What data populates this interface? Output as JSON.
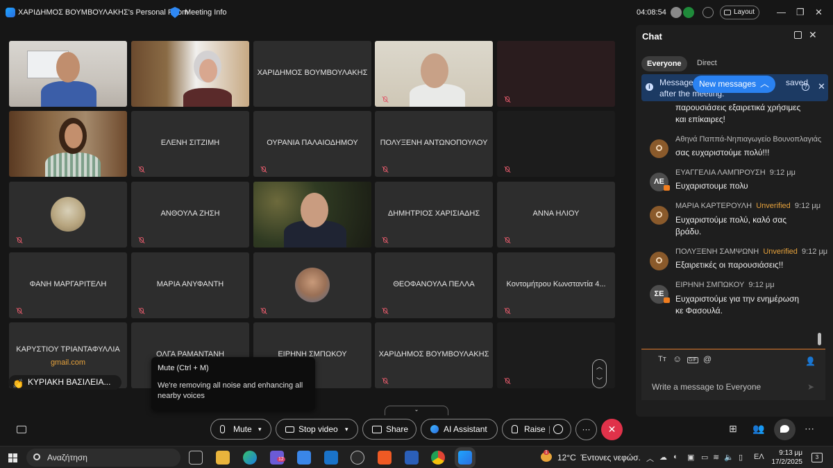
{
  "titlebar": {
    "title": "ΧΑΡΙΔΗΜΟΣ ΒΟΥΜΒΟΥΛΑΚΗΣ's Personal Room",
    "meeting_info": "Meeting Info",
    "timer": "04:08:54",
    "layout_label": "Layout"
  },
  "grid": {
    "tiles": [
      {
        "name": "",
        "type": "video"
      },
      {
        "name": "",
        "type": "video"
      },
      {
        "name": "ΧΑΡΙΔΗΜΟΣ ΒΟΥΜΒΟΥΛΑΚΗΣ",
        "type": "name"
      },
      {
        "name": "",
        "type": "video"
      },
      {
        "name": "",
        "type": "blank"
      },
      {
        "name": "",
        "type": "video"
      },
      {
        "name": "ΕΛΕΝΗ ΣΙΤΖΙΜΗ",
        "type": "name"
      },
      {
        "name": "ΟΥΡΑΝΙΑ ΠΑΛΑΙΟΔΗΜΟΥ",
        "type": "name"
      },
      {
        "name": "ΠΟΛΥΞΕΝΗ ΑΝΤΩΝΟΠΟΥΛΟΥ",
        "type": "name"
      },
      {
        "name": "",
        "type": "blank"
      },
      {
        "name": "",
        "type": "avatar"
      },
      {
        "name": "ΑΝΘΟΥΛΑ ΖΗΣΗ",
        "type": "name"
      },
      {
        "name": "",
        "type": "video"
      },
      {
        "name": "ΔΗΜΗΤΡΙΟΣ ΧΑΡΙΣΙΑΔΗΣ",
        "type": "name"
      },
      {
        "name": "ΑΝΝΑ ΗΛΙΟΥ",
        "type": "name"
      },
      {
        "name": "ΦΑΝΗ ΜΑΡΓΑΡΙΤΕΛΗ",
        "type": "name"
      },
      {
        "name": "ΜΑΡΙΑ ΑΝΥΦΑΝΤΗ",
        "type": "name"
      },
      {
        "name": "",
        "type": "avatar"
      },
      {
        "name": "ΘΕΟΦΑΝΟΥΛΑ ΠΕΛΛΑ",
        "type": "name"
      },
      {
        "name": "Κοντομήτρου Κωνσταντία 4...",
        "type": "name"
      },
      {
        "name": "ΚΑΡΥΣΤΙΟΥ ΤΡΙΑΝΤΑΦΥΛΛΙΑ",
        "type": "name",
        "sub": "gmail.com"
      },
      {
        "name": "ΟΛΓΑ ΡΑΜΑΝΤΑΝΗ",
        "type": "name"
      },
      {
        "name": "ΕΙΡΗΝΗ ΣΜΠΩΚΟΥ",
        "type": "name"
      },
      {
        "name": "ΧΑΡΙΔΗΜΟΣ ΒΟΥΜΒΟΥΛΑΚΗΣ",
        "type": "name"
      },
      {
        "name": "",
        "type": "blank"
      }
    ],
    "hand_raised_name": "ΚΥΡΙΑΚΗ ΒΑΣΙΛΕΙΑ...",
    "hand_icon": "👏"
  },
  "tooltip": {
    "title": "Mute  (Ctrl + M)",
    "body": "We're removing all noise and enhancing all nearby voices"
  },
  "controls": {
    "mute": "Mute",
    "stop_video": "Stop video",
    "share": "Share",
    "ai_assistant": "AI Assistant",
    "raise": "Raise",
    "more": "···",
    "leave": "✕"
  },
  "chat": {
    "title": "Chat",
    "tab_everyone": "Everyone",
    "tab_direct": "Direct",
    "notice_a": "Message",
    "notice_b": "saved",
    "notice_c": "after the meeting.",
    "new_messages": "New messages",
    "top_text_1": "παρουσιάσεις εξαιρετικά χρήσιμες",
    "top_text_2": "και επίκαιρες!",
    "messages": [
      {
        "sender": "Αθηνά Παππά-Νηπιαγωγείο Βουνοπλαγιάς",
        "unverified": "",
        "time": "",
        "text1": "σας ευχαριστούμε πολύ!!!",
        "text2": "",
        "initials": ""
      },
      {
        "sender": "ΕΥΑΓΓΕΛΙΑ ΛΑΜΠΡΟΥΣΗ",
        "unverified": "",
        "time": "9:12 μμ",
        "text1": "Ευχαριστουμε πολυ",
        "text2": "",
        "initials": "ΛΕ"
      },
      {
        "sender": "ΜΑΡΙΑ ΚΑΡΤΕΡΟΥΛΗ",
        "unverified": "Unverified",
        "time": "9:12 μμ",
        "text1": "Ευχαριστούμε πολύ, καλό σας",
        "text2": "βράδυ.",
        "initials": ""
      },
      {
        "sender": "ΠΟΛΥΞΕΝΗ ΣΑΜΨΩΝΗ",
        "unverified": "Unverified",
        "time": "9:12 μμ",
        "text1": "Εξαιρετικές οι παρουσιάσεις!!",
        "text2": "",
        "initials": ""
      },
      {
        "sender": "ΕΙΡΗΝΗ ΣΜΠΩΚΟΥ",
        "unverified": "",
        "time": "9:12 μμ",
        "text1": "Ευχαριστούμε για την ενημέρωση",
        "text2": "κε Φασουλά.",
        "initials": "ΣΕ"
      }
    ],
    "input_placeholder": "Write a message to Everyone",
    "format_icons": [
      "Tт",
      "☺",
      "GIF",
      "@"
    ]
  },
  "taskbar": {
    "search_placeholder": "Αναζήτηση",
    "weather_temp": "12°C",
    "weather_desc": "Έντονες νεφώσ.",
    "weather_badge": "1",
    "lang": "ΕΛ",
    "time": "9:13 μμ",
    "date": "17/2/2025",
    "notifications": "3",
    "teams_badge": "12"
  },
  "colors": {
    "accent": "#2a82f2",
    "leave": "#e0324a",
    "unverified": "#e6a23c",
    "muted_mic": "#e05a6a"
  }
}
